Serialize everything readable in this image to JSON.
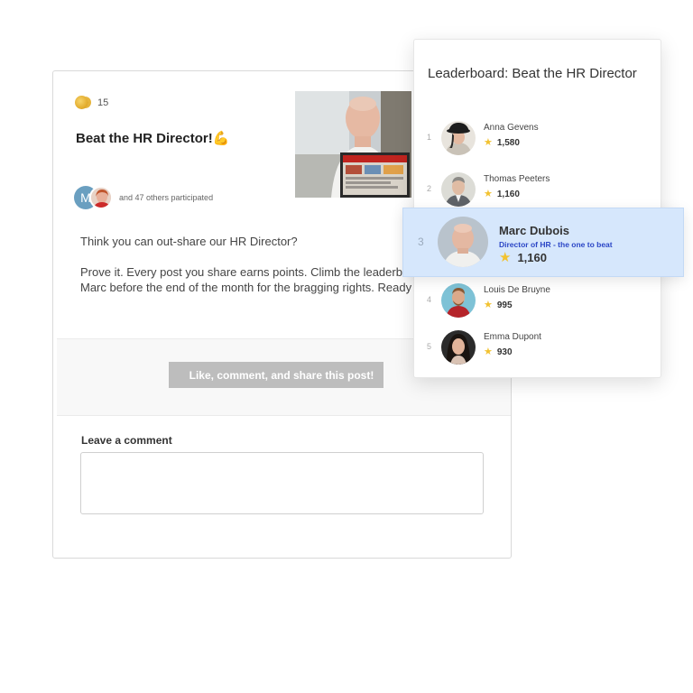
{
  "post": {
    "points": "15",
    "title": "Beat the HR Director!",
    "title_emoji": "💪",
    "participants_initial": "M",
    "participants_text": "and 47 others participated",
    "paragraph1": "Think you can out-share our HR Director?",
    "paragraph2_line1": "Prove it. Every post you share earns points. Climb the leaderb",
    "paragraph2_line2": "Marc before the end of the month for the bragging rights. Ready",
    "action_button": "Like, comment, and share this post!",
    "comment_label": "Leave a comment",
    "comment_placeholder": ""
  },
  "leaderboard": {
    "title": "Leaderboard: Beat the HR Director",
    "entries": [
      {
        "rank": "1",
        "name": "Anna Gevens",
        "score": "1,580"
      },
      {
        "rank": "2",
        "name": "Thomas Peeters",
        "score": "1,160"
      },
      {
        "rank": "3",
        "name": "Marc Dubois",
        "subtitle": "Director of HR - the one to beat",
        "score": "1,160"
      },
      {
        "rank": "4",
        "name": "Louis De Bruyne",
        "score": "995"
      },
      {
        "rank": "5",
        "name": "Emma Dupont",
        "score": "930"
      }
    ]
  },
  "colors": {
    "highlight_bg": "#d6e7fc",
    "subtitle_blue": "#2b46c6",
    "star": "#f2c230",
    "button_gray": "#bdbdbd"
  }
}
